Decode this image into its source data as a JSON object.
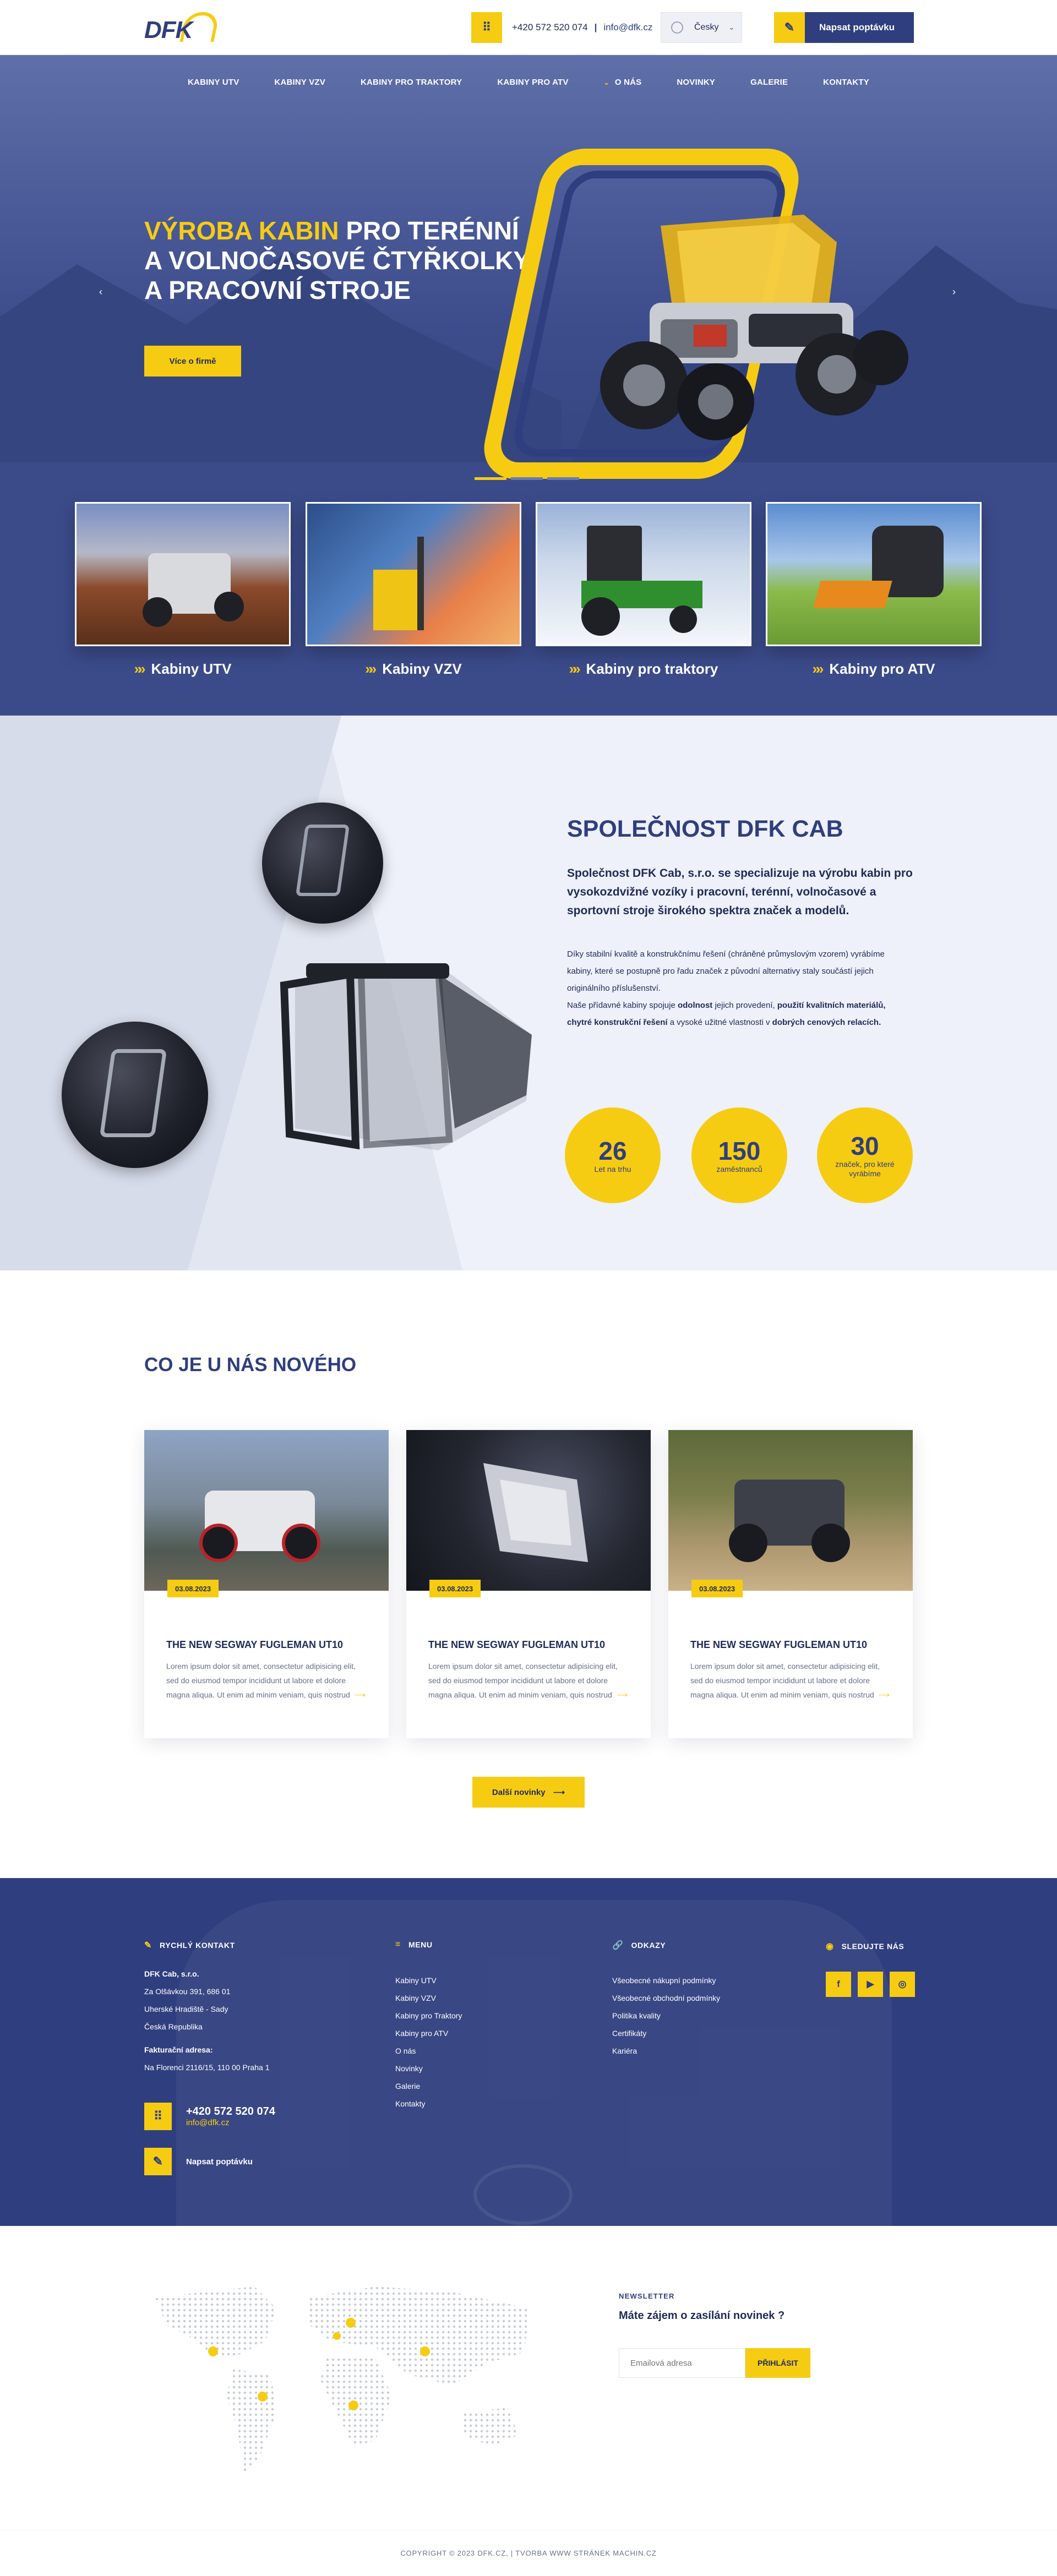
{
  "header": {
    "logo_text": "DFK",
    "phone_icon": "keypad-icon",
    "phone": "+420 572 520 074",
    "separator": "|",
    "email": "info@dfk.cz",
    "language": "Česky",
    "quote_label": "Napsat poptávku",
    "quote_icon": "edit-note-icon"
  },
  "nav": {
    "items": [
      {
        "label": "KABINY UTV"
      },
      {
        "label": "KABINY VZV"
      },
      {
        "label": "KABINY PRO TRAKTORY"
      },
      {
        "label": "KABINY PRO ATV"
      },
      {
        "label": "O NÁS"
      },
      {
        "label": "NOVINKY"
      },
      {
        "label": "GALERIE"
      },
      {
        "label": "KONTAKTY"
      }
    ]
  },
  "hero": {
    "title_highlight": "VÝROBA KABIN",
    "title_rest": " PRO TERÉNNÍ A VOLNOČASOVÉ ČTYŘKOLKY A PRACOVNÍ STROJE",
    "button": "Více o firmě",
    "prev_arrow": "‹",
    "next_arrow": "›"
  },
  "categories": [
    {
      "label": "Kabiny UTV"
    },
    {
      "label": "Kabiny VZV"
    },
    {
      "label": "Kabiny pro traktory"
    },
    {
      "label": "Kabiny pro ATV"
    }
  ],
  "company": {
    "title": "SPOLEČNOST DFK CAB",
    "lead": "Společnost DFK Cab, s.r.o. se specializuje na výrobu kabin pro vysokozdvižné vozíky i pracovní, terénní, volnočasové a sportovní stroje širokého spektra značek a modelů.",
    "p1": "Díky stabilní kvalitě a konstrukčnímu řešení (chráněné průmyslovým vzorem) vyrábíme kabiny, které se postupně pro řadu značek z původní alternativy staly součástí jejich originálního příslušenství.",
    "p2a": "Naše přídavné kabiny spojuje ",
    "p2b": "odolnost",
    "p2c": " jejich provedení, ",
    "p2d": "použití kvalitních materiálů, chytré konstrukční řešení",
    "p2e": " a vysoké užitné vlastnosti v ",
    "p2f": "dobrých cenových relacích.",
    "stats": [
      {
        "value": "26",
        "label": "Let na trhu"
      },
      {
        "value": "150",
        "label": "zaměstnanců"
      },
      {
        "value": "30",
        "label": "značek, pro které vyrábíme"
      }
    ]
  },
  "news": {
    "title": "CO JE U NÁS NOVÉHO",
    "items": [
      {
        "date": "03.08.2023",
        "title": "THE NEW SEGWAY FUGLEMAN UT10",
        "text": "Lorem ipsum dolor sit amet, consectetur adipisicing elit, sed do eiusmod tempor incididunt ut labore et dolore magna aliqua. Ut enim ad minim veniam, quis nostrud"
      },
      {
        "date": "03.08.2023",
        "title": "THE NEW SEGWAY FUGLEMAN UT10",
        "text": "Lorem ipsum dolor sit amet, consectetur adipisicing elit, sed do eiusmod tempor incididunt ut labore et dolore magna aliqua. Ut enim ad minim veniam, quis nostrud"
      },
      {
        "date": "03.08.2023",
        "title": "THE NEW SEGWAY FUGLEMAN UT10",
        "text": "Lorem ipsum dolor sit amet, consectetur adipisicing elit, sed do eiusmod tempor incididunt ut labore et dolore magna aliqua. Ut enim ad minim veniam, quis nostrud"
      }
    ],
    "more": "Další novinky",
    "arrow": "⟶"
  },
  "footer": {
    "contact_title": "RYCHLÝ KONTAKT",
    "company_name": "DFK Cab, s.r.o.",
    "address1": "Za Olšávkou 391, 686 01",
    "address2": "Uherské Hradiště - Sady",
    "address3": "Česká Republika",
    "billing_label": "Fakturační adresa:",
    "billing": "Na Florenci 2116/15, 110 00 Praha 1",
    "phone": "+420 572 520 074",
    "email": "info@dfk.cz",
    "quote": "Napsat poptávku",
    "menu_title": "MENU",
    "menu": [
      "Kabiny UTV",
      "Kabiny VZV",
      "Kabiny pro Traktory",
      "Kabiny pro ATV",
      "O nás",
      "Novinky",
      "Galerie",
      "Kontakty"
    ],
    "links_title": "ODKAZY",
    "links": [
      "Všeobecné nákupní podmínky",
      "Všeobecné obchodní podmínky",
      "Politika kvality",
      "Certifikáty",
      "Kariéra"
    ],
    "social_title": "SLEDUJTE NÁS",
    "social": [
      "f",
      "▶",
      "◎"
    ]
  },
  "newsletter": {
    "kicker": "NEWSLETTER",
    "question": "Máte zájem o zasílání novinek ?",
    "placeholder": "Emailová adresa",
    "button": "PŘIHLÁSIT"
  },
  "copyright": "COPYRIGHT © 2023 DFK.CZ, | TVORBA WWW STRÁNEK MACHIN.CZ",
  "colors": {
    "navy": "#2f3e7e",
    "yellow": "#f6cc12",
    "light": "#eef1fa"
  }
}
